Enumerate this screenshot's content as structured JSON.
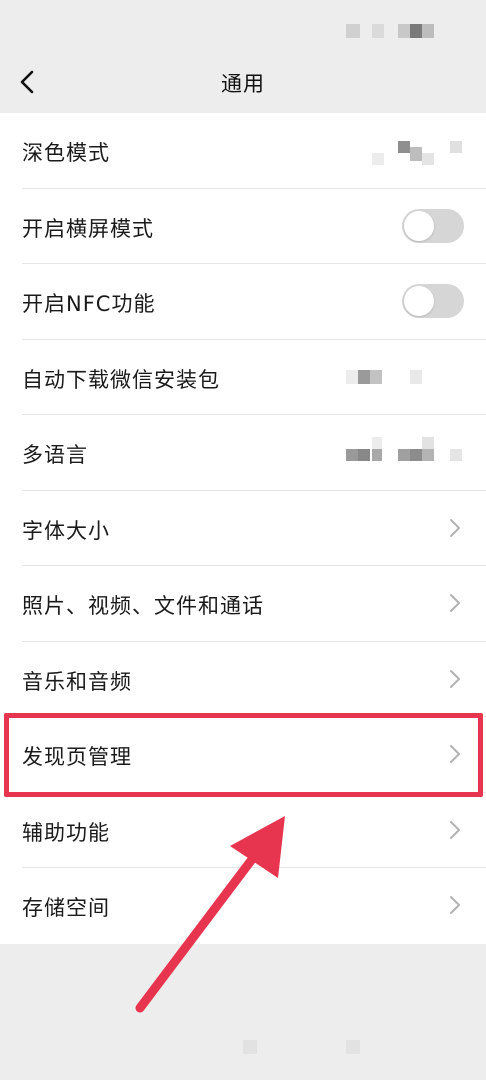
{
  "nav": {
    "title": "通用"
  },
  "settings": {
    "rows": [
      {
        "label": "深色模式",
        "control": "blurred-value"
      },
      {
        "label": "开启横屏模式",
        "control": "toggle",
        "on": false
      },
      {
        "label": "开启NFC功能",
        "control": "toggle",
        "on": false
      },
      {
        "label": "自动下载微信安装包",
        "control": "blurred-value"
      },
      {
        "label": "多语言",
        "control": "blurred-value"
      },
      {
        "label": "字体大小",
        "control": "chevron"
      },
      {
        "label": "照片、视频、文件和通话",
        "control": "chevron"
      },
      {
        "label": "音乐和音频",
        "control": "chevron"
      },
      {
        "label": "发现页管理",
        "control": "chevron",
        "highlighted": true
      },
      {
        "label": "辅助功能",
        "control": "chevron"
      },
      {
        "label": "存储空间",
        "control": "chevron"
      }
    ]
  },
  "colors": {
    "background": "#ededed",
    "list_background": "#ffffff",
    "highlight": "#e8354f",
    "toggle_off": "#d6d6d6"
  },
  "icons": {
    "back": "chevron-left-icon",
    "row_arrow": "chevron-right-icon"
  }
}
